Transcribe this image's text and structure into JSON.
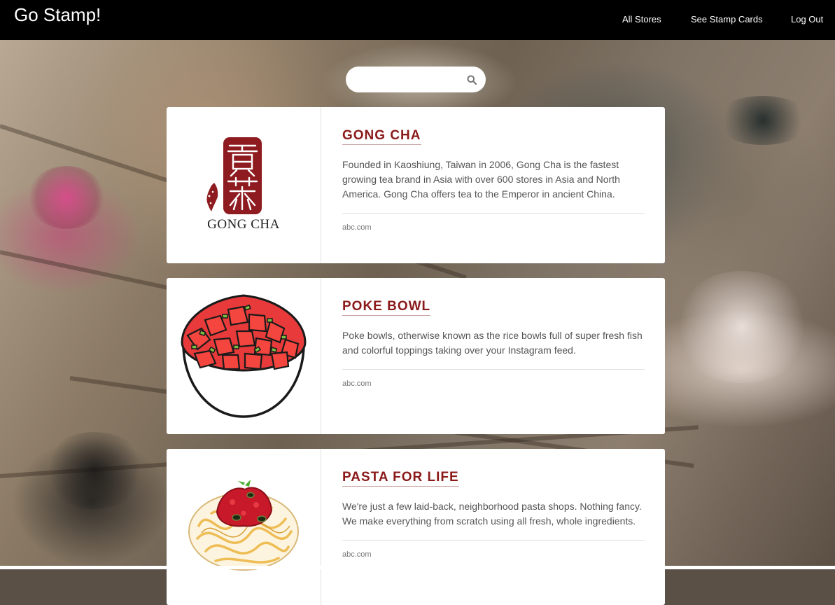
{
  "navbar": {
    "brand": "Go Stamp!",
    "links": [
      "All Stores",
      "See Stamp Cards",
      "Log Out"
    ]
  },
  "search": {
    "placeholder": "",
    "value": "",
    "icon": "search-icon"
  },
  "stores": [
    {
      "name": "GONG CHA",
      "description": "Founded in Kaoshiung, Taiwan in 2006, Gong Cha is the fastest growing tea brand in Asia with over 600 stores in Asia and North America. Gong Cha offers tea to the Emperor in ancient China.",
      "link": "abc.com",
      "logo_text": "GONG CHA",
      "logo_icon": "gong-cha-logo"
    },
    {
      "name": "POKE BOWL",
      "description": "Poke bowls, otherwise known as the rice bowls full of super fresh fish and colorful toppings taking over your Instagram feed.",
      "link": "abc.com",
      "logo_icon": "poke-bowl-illustration"
    },
    {
      "name": "PASTA FOR LIFE",
      "description": "We're just a few laid-back, neighborhood pasta shops. Nothing fancy. We make everything from scratch using all fresh, whole ingredients.",
      "link": "abc.com",
      "logo_icon": "pasta-plate-illustration"
    }
  ],
  "colors": {
    "navbar_bg": "#000000",
    "store_name": "#8b1a1a",
    "card_bg": "#ffffff"
  }
}
